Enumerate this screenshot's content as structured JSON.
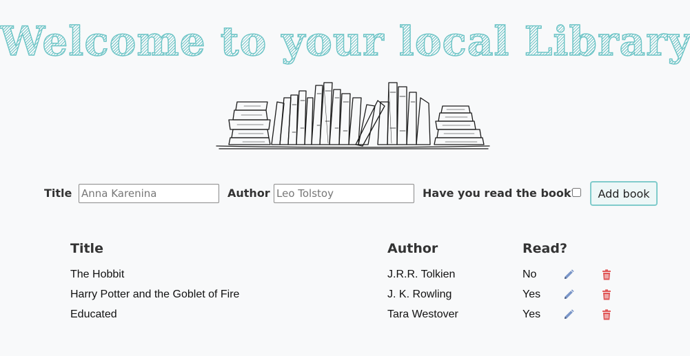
{
  "header": {
    "title": "Welcome to your local Library!"
  },
  "form": {
    "title_label": "Title",
    "title_placeholder": "Anna Karenina",
    "author_label": "Author",
    "author_placeholder": "Leo Tolstoy",
    "read_label": "Have you read the book?",
    "read_checked": false,
    "add_button": "Add book"
  },
  "table": {
    "headers": {
      "title": "Title",
      "author": "Author",
      "read": "Read?"
    },
    "rows": [
      {
        "title": "The Hobbit",
        "author": "J.R.R. Tolkien",
        "read": "No"
      },
      {
        "title": "Harry Potter and the Goblet of Fire",
        "author": "J. K. Rowling",
        "read": "Yes"
      },
      {
        "title": "Educated",
        "author": "Tara Westover",
        "read": "Yes"
      }
    ]
  },
  "icons": {
    "edit": "pencil-icon",
    "delete": "trash-icon"
  },
  "colors": {
    "accent": "#6cc4c6",
    "edit_icon": "#7a96c8",
    "delete_icon": "#e05555",
    "background": "#f8f9fa"
  }
}
